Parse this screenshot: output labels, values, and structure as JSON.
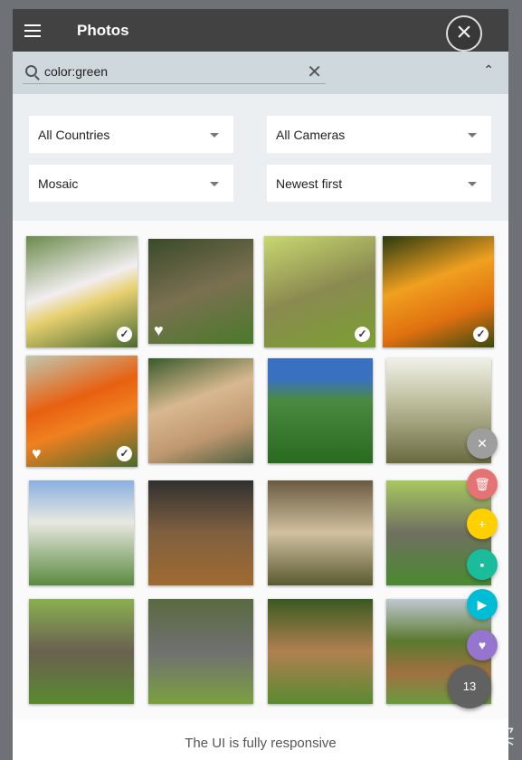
{
  "header": {
    "title": "Photos",
    "menu_icon": "hamburger-icon",
    "close_icon": "close-icon"
  },
  "search": {
    "value": "color:green",
    "clear_icon": "clear-icon",
    "collapse_icon": "chevron-up-icon"
  },
  "filters": {
    "country": "All Countries",
    "camera": "All Cameras",
    "view": "Mosaic",
    "sort": "Newest first"
  },
  "photos": [
    {
      "subject": "water lily",
      "selected": true,
      "favorite": false
    },
    {
      "subject": "chameleon",
      "selected": false,
      "favorite": true
    },
    {
      "subject": "chameleon",
      "selected": true,
      "favorite": false
    },
    {
      "subject": "orange flowers",
      "selected": true,
      "favorite": false
    },
    {
      "subject": "orange flowers",
      "selected": true,
      "favorite": true
    },
    {
      "subject": "dog",
      "selected": false,
      "favorite": false
    },
    {
      "subject": "plants",
      "selected": false,
      "favorite": false
    },
    {
      "subject": "coast",
      "selected": false,
      "favorite": false
    },
    {
      "subject": "building garden",
      "selected": false,
      "favorite": false
    },
    {
      "subject": "market",
      "selected": false,
      "favorite": false
    },
    {
      "subject": "lion",
      "selected": false,
      "favorite": false
    },
    {
      "subject": "baboons",
      "selected": false,
      "favorite": false
    },
    {
      "subject": "baboon",
      "selected": false,
      "favorite": false
    },
    {
      "subject": "rhino",
      "selected": false,
      "favorite": false
    },
    {
      "subject": "antelope",
      "selected": false,
      "favorite": false
    },
    {
      "subject": "giraffe",
      "selected": false,
      "favorite": false
    }
  ],
  "actions": [
    {
      "name": "clear-selection",
      "icon": "close-icon",
      "color": "#9e9e9e"
    },
    {
      "name": "delete",
      "icon": "trash-icon",
      "color": "#e57373"
    },
    {
      "name": "add-to-album",
      "icon": "folder-add-icon",
      "color": "#ffd000"
    },
    {
      "name": "download",
      "icon": "save-icon",
      "color": "#1abc9c"
    },
    {
      "name": "label",
      "icon": "label-icon",
      "color": "#00bcd4"
    },
    {
      "name": "favorite",
      "icon": "heart-icon",
      "color": "#9575cd"
    }
  ],
  "selection_count": "13",
  "footer": {
    "text": "The UI is fully responsive"
  },
  "watermark": "值 什么值得买"
}
